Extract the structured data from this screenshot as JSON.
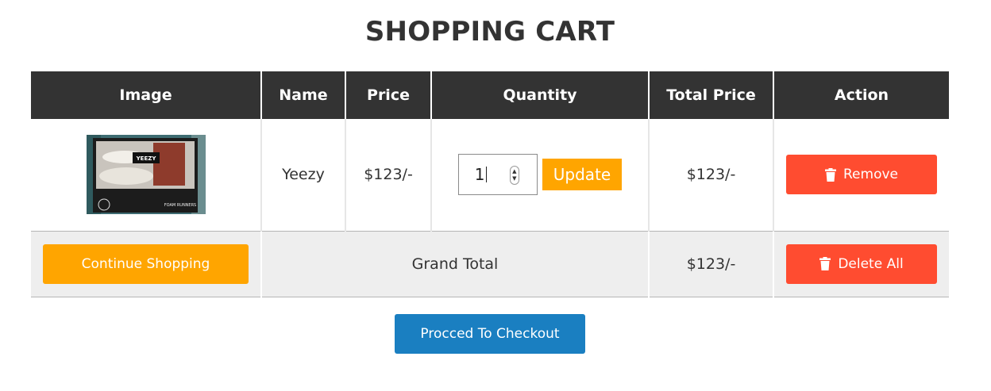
{
  "page": {
    "title": "SHOPPING CART"
  },
  "table": {
    "headers": [
      "Image",
      "Name",
      "Price",
      "Quantity",
      "Total Price",
      "Action"
    ],
    "items": [
      {
        "image_alt": "Yeezy Foam Runners box",
        "image_text_top": "YEEZY",
        "image_text_bottom": "FOAM RUNNERS",
        "name": "Yeezy",
        "price": "$123/-",
        "quantity": "1",
        "update_label": "Update",
        "total": "$123/-",
        "remove_label": "Remove"
      }
    ]
  },
  "footer": {
    "continue_label": "Continue Shopping",
    "grand_total_label": "Grand Total",
    "grand_total_value": "$123/-",
    "delete_all_label": "Delete All"
  },
  "checkout_label": "Procced To Checkout",
  "colors": {
    "header_bg": "#333333",
    "orange": "#ffa500",
    "red": "#ff4c30",
    "blue": "#1a7fc1"
  },
  "icons": {
    "remove": "trash-icon",
    "delete_all": "trash-icon"
  }
}
